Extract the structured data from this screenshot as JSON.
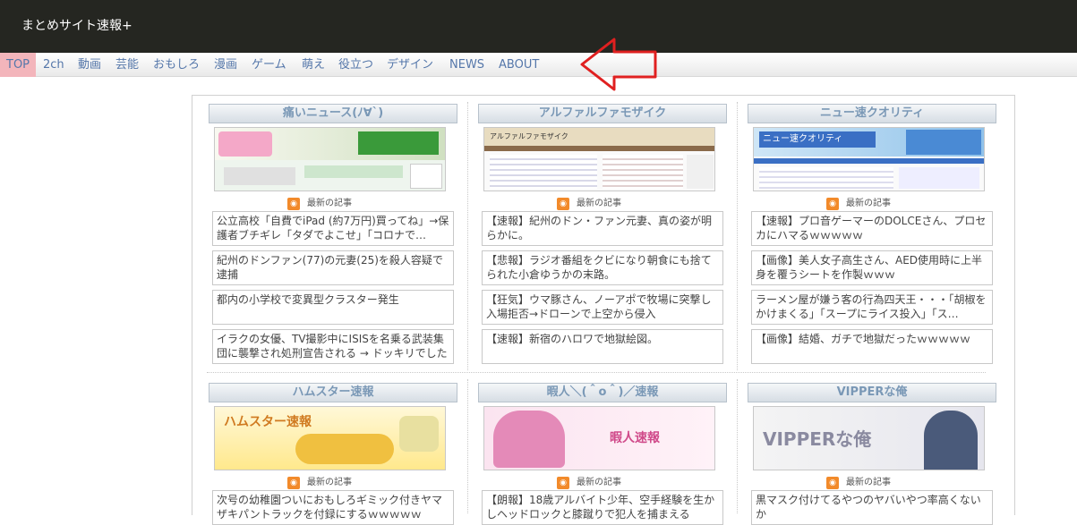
{
  "header": {
    "title": "まとめサイト速報+"
  },
  "nav": {
    "items": [
      {
        "label": "TOP"
      },
      {
        "label": "2ch"
      },
      {
        "label": "動画"
      },
      {
        "label": "芸能"
      },
      {
        "label": "おもしろ"
      },
      {
        "label": "漫画"
      },
      {
        "label": "ゲーム"
      },
      {
        "label": "萌え"
      },
      {
        "label": "役立つ"
      },
      {
        "label": "デザイン"
      },
      {
        "label": "NEWS"
      },
      {
        "label": "ABOUT"
      }
    ],
    "active": "TOP"
  },
  "latest_label": "最新の記事",
  "sites": [
    {
      "name": "痛いニュース(ﾉ∀`)",
      "articles": [
        "公立高校「自費でiPad (約7万円)買ってね」→保護者ブチギレ「タダでよこせ」「コロナで…",
        "紀州のドンファン(77)の元妻(25)を殺人容疑で逮捕",
        "都内の小学校で変異型クラスター発生",
        "イラクの女優、TV撮影中にISISを名乗る武装集団に襲撃され処刑宣告される → ドッキリでした"
      ]
    },
    {
      "name": "アルファルファモザイク",
      "thumb_text": "アルファルファモザイク",
      "articles": [
        "【速報】紀州のドン・ファン元妻、真の姿が明らかに。",
        "【悲報】ラジオ番組をクビになり朝食にも捨てられた小倉ゆうかの末路。",
        "【狂気】ウマ豚さん、ノーアポで牧場に突撃し入場拒否→ドローンで上空から侵入",
        "【速報】新宿のハロワで地獄絵図。"
      ]
    },
    {
      "name": "ニュー速クオリティ",
      "thumb_text": "ニュー速クオリティ",
      "articles": [
        "【速報】プロ音ゲーマーのDOLCEさん、プロセカにハマるｗｗｗｗｗ",
        "【画像】美人女子高生さん、AED使用時に上半身を覆うシートを作製ｗｗｗ",
        "ラーメン屋が嫌う客の行為四天王・・・「胡椒をかけまくる」「スープにライス投入」「ス…",
        "【画像】結婚、ガチで地獄だったｗｗｗｗｗ"
      ]
    },
    {
      "name": "ハムスター速報",
      "thumb_text": "ハムスター速報",
      "articles": [
        "次号の幼稚園ついにおもしろギミック付きヤマザキパントラックを付録にするｗｗｗｗｗ"
      ]
    },
    {
      "name": "暇人＼(＾o＾)／速報",
      "thumb_text": "暇人速報",
      "articles": [
        "【朗報】18歳アルバイト少年、空手経験を生かしヘッドロックと膝蹴りで犯人を捕まえる"
      ]
    },
    {
      "name": "VIPPERな俺",
      "thumb_text": "VIPPERな俺",
      "articles": [
        "黒マスク付けてるやつのヤバいやつ率高くないか"
      ]
    }
  ],
  "colors": {
    "header_bg": "#252621",
    "nav_active_bg": "#f3b5bb",
    "nav_text": "#5577aa",
    "site_head_text": "#7a98b6",
    "arrow": "#e02020"
  }
}
